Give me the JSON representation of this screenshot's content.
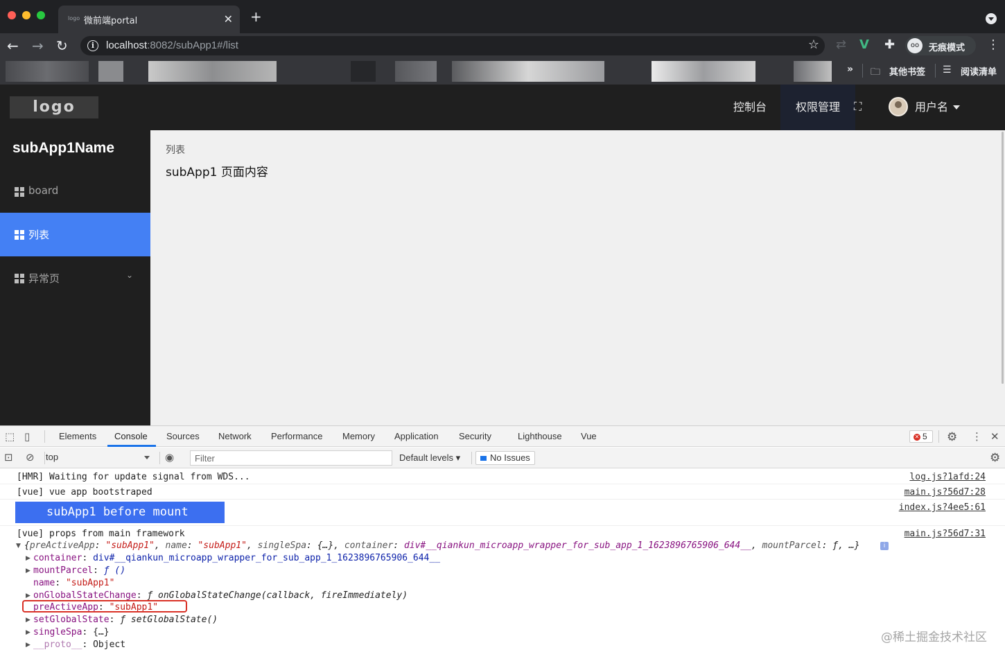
{
  "browser": {
    "tab_title": "微前端portal",
    "tab_favicon_text": "logo",
    "url_host": "localhost",
    "url_rest": ":8082/subApp1#/list",
    "profile_label": "无痕模式",
    "bookmarks_more": "»",
    "bookmarks": [
      {
        "label": "其他书签",
        "icon": "folder-icon"
      },
      {
        "label": "阅读清单",
        "icon": "reading-list-icon"
      }
    ]
  },
  "app": {
    "logo_text": "logo",
    "header_nav": [
      "控制台",
      "权限管理"
    ],
    "username": "用户名",
    "sub_app_title": "subApp1Name",
    "menu": [
      {
        "label": "board",
        "selected": false
      },
      {
        "label": "列表",
        "selected": true
      },
      {
        "label": "异常页",
        "selected": false,
        "has_submenu": true
      }
    ],
    "breadcrumb": "列表",
    "page_text": "subApp1 页面内容"
  },
  "devtools": {
    "tabs": [
      "Elements",
      "Console",
      "Sources",
      "Network",
      "Performance",
      "Memory",
      "Application",
      "Security",
      "Lighthouse",
      "Vue"
    ],
    "active_tab": "Console",
    "error_count": "5",
    "context": "top",
    "filter_placeholder": "Filter",
    "levels": "Default levels ▾",
    "issues": "No Issues",
    "console": {
      "lines": [
        {
          "text": "[HMR] Waiting for update signal from WDS...",
          "src": "log.js?1afd:24"
        },
        {
          "text": "[vue] vue app bootstraped",
          "src": "main.js?56d7:28"
        },
        {
          "text": "subApp1 before mount",
          "src": "index.js?4ee5:61"
        },
        {
          "text": "[vue] props from main framework",
          "src": "main.js?56d7:31"
        }
      ],
      "object_summary": {
        "open": "{",
        "k1": "preActiveApp",
        "v1": "\"subApp1\"",
        "k2": "name",
        "v2": "\"subApp1\"",
        "k3": "singleSpa",
        "v3": "{…}",
        "k4": "container",
        "v4": "div#__qiankun_microapp_wrapper_for_sub_app_1_1623896765906_644__",
        "k5": "mountParcel",
        "v5": "ƒ",
        "tail": ", …}"
      },
      "props": [
        {
          "key": "container",
          "value": "div#__qiankun_microapp_wrapper_for_sub_app_1_1623896765906_644__",
          "expandable": true
        },
        {
          "key": "mountParcel",
          "value": "ƒ ()",
          "expandable": true
        },
        {
          "key": "name",
          "value": "\"subApp1\"",
          "expandable": false
        },
        {
          "key": "onGlobalStateChange",
          "value": "ƒ onGlobalStateChange(callback, fireImmediately)",
          "expandable": true
        },
        {
          "key": "preActiveApp",
          "value": "\"subApp1\"",
          "expandable": false
        },
        {
          "key": "setGlobalState",
          "value": "ƒ setGlobalState()",
          "expandable": true
        },
        {
          "key": "singleSpa",
          "value": "{…}",
          "expandable": true
        },
        {
          "key": "__proto__",
          "value": "Object",
          "expandable": true
        }
      ]
    }
  },
  "watermark": "@稀土掘金技术社区"
}
